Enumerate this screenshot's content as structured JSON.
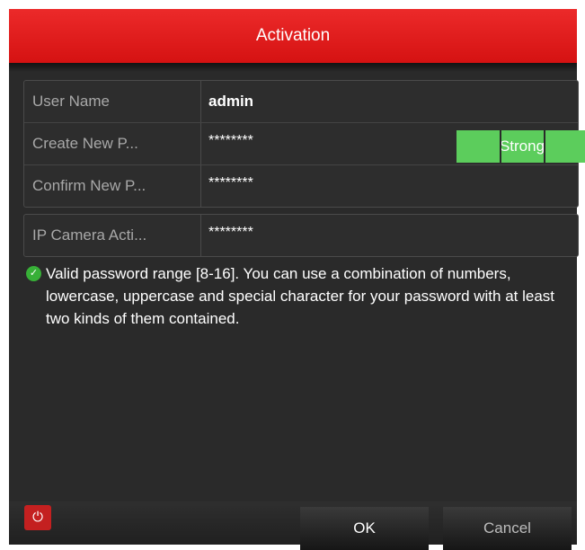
{
  "dialog": {
    "title": "Activation",
    "fields": {
      "user_name": {
        "label": "User Name",
        "value": "admin"
      },
      "create_password": {
        "label": "Create New P...",
        "value": "********",
        "strength": "Strong"
      },
      "confirm_password": {
        "label": "Confirm New P...",
        "value": "********"
      },
      "ip_camera_password": {
        "label": "IP Camera Acti...",
        "value": "********"
      }
    },
    "hint": "Valid password range [8-16]. You can use a combination of numbers, lowercase, uppercase and special character for your password with at least two kinds of them contained.",
    "icons": {
      "hint": "check-circle-icon",
      "power": "power-icon"
    },
    "buttons": {
      "ok": "OK",
      "cancel": "Cancel"
    },
    "colors": {
      "title_bar": "#e41e1e",
      "strength": "#5ccd5c",
      "background": "#2a2a2a"
    }
  }
}
